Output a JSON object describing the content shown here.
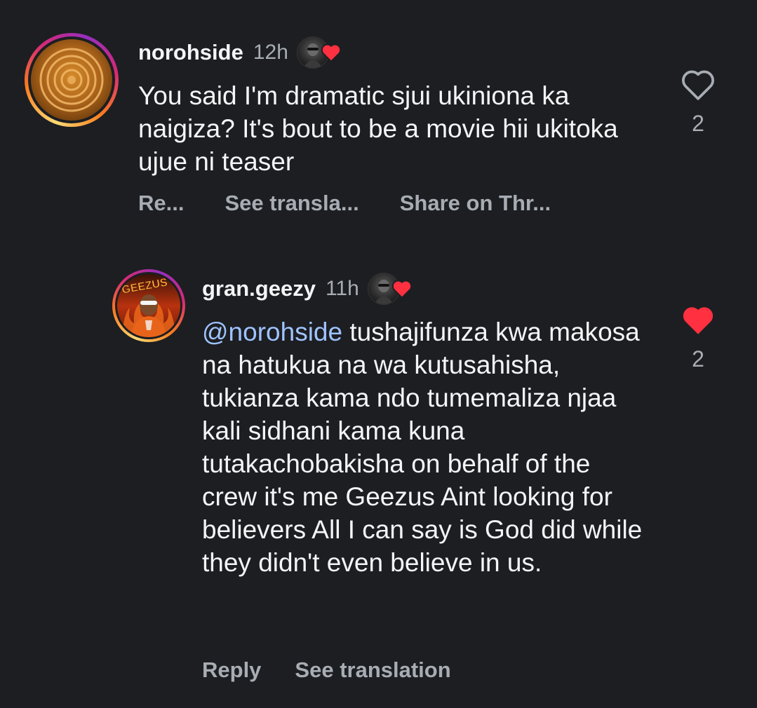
{
  "comments": [
    {
      "username": "norohside",
      "time": "12h",
      "text": "You said I'm dramatic sjui ukiniona ka naigiza? It's bout to be a movie hii ukitoka ujue ni teaser",
      "actions": [
        "Re...",
        "See transla...",
        "Share on Thr..."
      ],
      "like_count": "2",
      "liked": false,
      "avatar": "gold-rings-avatar"
    },
    {
      "username": "gran.geezy",
      "time": "11h",
      "mention": "@norohside",
      "text": " tushajifunza kwa makosa na hatukua na wa kutusahisha, tukianza kama ndo tumemaliza njaa kali sidhani kama kuna tutakachobakisha on behalf of the crew it's me Geezus Aint looking for believers All I can say is God did while they didn't even believe in us.",
      "actions": [
        "Reply",
        "See translation"
      ],
      "like_count": "2",
      "liked": true,
      "avatar": "geezus-avatar",
      "avatar_label": "GEEZUS"
    }
  ],
  "colors": {
    "background": "#1c1e22",
    "heart_red": "#ff3040",
    "mention_blue": "#9fc3ff"
  }
}
